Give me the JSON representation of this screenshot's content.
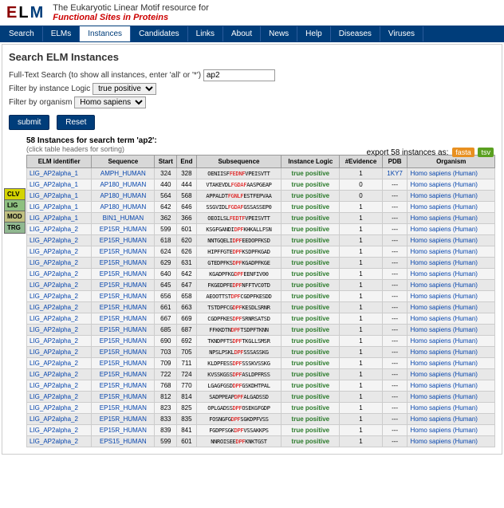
{
  "header": {
    "logo_e": "E",
    "logo_l": "L",
    "logo_m": "M",
    "tagline_1": "The Eukaryotic Linear Motif resource for",
    "tagline_2": "Functional Sites in Proteins"
  },
  "nav": [
    "Search",
    "ELMs",
    "Instances",
    "Candidates",
    "Links",
    "About",
    "News",
    "Help",
    "Diseases",
    "Viruses"
  ],
  "nav_active": 2,
  "page_title": "Search ELM Instances",
  "filters": {
    "fulltext_label": "Full-Text Search (to show all instances, enter 'all' or '*')",
    "fulltext_value": "ap2",
    "logic_label": "Filter by instance Logic",
    "logic_value": "true positive",
    "organism_label": "Filter by organism",
    "organism_value": "Homo sapiens"
  },
  "buttons": {
    "submit": "submit",
    "reset": "Reset"
  },
  "export": {
    "label": "export 58 instances as:",
    "fasta": "fasta",
    "tsv": "tsv"
  },
  "results": {
    "heading": "58 Instances for search term 'ap2':",
    "note": "(click table headers for sorting)"
  },
  "sidetabs": {
    "clv": "CLV",
    "lig": "LIG",
    "mod": "MOD",
    "trg": "TRG"
  },
  "columns": [
    "ELM identifier",
    "Sequence",
    "Start",
    "End",
    "Subsequence",
    "Instance Logic",
    "#Evidence",
    "PDB",
    "Organism"
  ],
  "rows": [
    {
      "id": "LIG_AP2alpha_1",
      "seq": "AMPH_HUMAN",
      "s": 324,
      "e": 328,
      "sub": "OENIISF<r>FEDNF</r>VPEISVTT",
      "logic": "true positive",
      "ev": 1,
      "pdb": "1KY7",
      "org": "Homo sapiens (Human)"
    },
    {
      "id": "LIG_AP2alpha_1",
      "seq": "AP180_HUMAN",
      "s": 440,
      "e": 444,
      "sub": "VTAKEVDL<r>FGDAF</r>AASPGEAP",
      "logic": "true positive",
      "ev": 0,
      "pdb": "---",
      "org": "Homo sapiens (Human)"
    },
    {
      "id": "LIG_AP2alpha_1",
      "seq": "AP180_HUMAN",
      "s": 564,
      "e": 568,
      "sub": "APPALDT<r>FGNLF</r>ESTFEPVAA",
      "logic": "true positive",
      "ev": 0,
      "pdb": "---",
      "org": "Homo sapiens (Human)"
    },
    {
      "id": "LIG_AP2alpha_1",
      "seq": "AP180_HUMAN",
      "s": 642,
      "e": 646,
      "sub": "SSGVIDL<r>FGDAF</r>GSSASSEP0",
      "logic": "true positive",
      "ev": 1,
      "pdb": "---",
      "org": "Homo sapiens (Human)"
    },
    {
      "id": "LIG_AP2alpha_1",
      "seq": "BIN1_HUMAN",
      "s": 362,
      "e": 366,
      "sub": "OEOILSL<r>FEDTF</r>VPEISVTT",
      "logic": "true positive",
      "ev": 1,
      "pdb": "---",
      "org": "Homo sapiens (Human)"
    },
    {
      "id": "LIG_AP2alpha_2",
      "seq": "EP15R_HUMAN",
      "s": 599,
      "e": 601,
      "sub": "KSGFGANDI<r>DPF</r>KHKALLFSN",
      "logic": "true positive",
      "ev": 1,
      "pdb": "---",
      "org": "Homo sapiens (Human)"
    },
    {
      "id": "LIG_AP2alpha_2",
      "seq": "EP15R_HUMAN",
      "s": 618,
      "e": 620,
      "sub": "NNTGQELI<r>DPF</r>EEDOPFKSD",
      "logic": "true positive",
      "ev": 1,
      "pdb": "---",
      "org": "Homo sapiens (Human)"
    },
    {
      "id": "LIG_AP2alpha_2",
      "seq": "EP15R_HUMAN",
      "s": 624,
      "e": 626,
      "sub": "HIPFFGTE<r>DPF</r>KSDPFKGAD",
      "logic": "true positive",
      "ev": 1,
      "pdb": "---",
      "org": "Homo sapiens (Human)"
    },
    {
      "id": "LIG_AP2alpha_2",
      "seq": "EP15R_HUMAN",
      "s": 629,
      "e": 631,
      "sub": "GTEDPFKS<r>DPF</r>KGADPFKGE",
      "logic": "true positive",
      "ev": 1,
      "pdb": "---",
      "org": "Homo sapiens (Human)"
    },
    {
      "id": "LIG_AP2alpha_2",
      "seq": "EP15R_HUMAN",
      "s": 640,
      "e": 642,
      "sub": "KGADPFKG<r>DPF</r>EENFIV00",
      "logic": "true positive",
      "ev": 1,
      "pdb": "---",
      "org": "Homo sapiens (Human)"
    },
    {
      "id": "LIG_AP2alpha_2",
      "seq": "EP15R_HUMAN",
      "s": 645,
      "e": 647,
      "sub": "FKGEDPFE<r>DPF</r>NFFTVC0TD",
      "logic": "true positive",
      "ev": 1,
      "pdb": "---",
      "org": "Homo sapiens (Human)"
    },
    {
      "id": "LIG_AP2alpha_2",
      "seq": "EP15R_HUMAN",
      "s": 656,
      "e": 658,
      "sub": "AEOOTTST<r>DPF</r>CGDPFKESDD",
      "logic": "true positive",
      "ev": 1,
      "pdb": "---",
      "org": "Homo sapiens (Human)"
    },
    {
      "id": "LIG_AP2alpha_2",
      "seq": "EP15R_HUMAN",
      "s": 661,
      "e": 663,
      "sub": "TSTDPFCG<r>DPF</r>KESDLSRNR",
      "logic": "true positive",
      "ev": 1,
      "pdb": "---",
      "org": "Homo sapiens (Human)"
    },
    {
      "id": "LIG_AP2alpha_2",
      "seq": "EP15R_HUMAN",
      "s": 667,
      "e": 669,
      "sub": "CGDPFKES<r>DPF</r>SRNRSATSD",
      "logic": "true positive",
      "ev": 1,
      "pdb": "---",
      "org": "Homo sapiens (Human)"
    },
    {
      "id": "LIG_AP2alpha_2",
      "seq": "EP15R_HUMAN",
      "s": 685,
      "e": 687,
      "sub": "FFKKDTN<r>DPF</r>TSDPFTKNN",
      "logic": "true positive",
      "ev": 1,
      "pdb": "---",
      "org": "Homo sapiens (Human)"
    },
    {
      "id": "LIG_AP2alpha_2",
      "seq": "EP15R_HUMAN",
      "s": 690,
      "e": 692,
      "sub": "TKNDPFTS<r>DPF</r>TKGLLSMSR",
      "logic": "true positive",
      "ev": 1,
      "pdb": "---",
      "org": "Homo sapiens (Human)"
    },
    {
      "id": "LIG_AP2alpha_2",
      "seq": "EP15R_HUMAN",
      "s": 703,
      "e": 705,
      "sub": "NPSLPSKL<r>DPF</r>SSSASSKG",
      "logic": "true positive",
      "ev": 1,
      "pdb": "---",
      "org": "Homo sapiens (Human)"
    },
    {
      "id": "LIG_AP2alpha_2",
      "seq": "EP15R_HUMAN",
      "s": 709,
      "e": 711,
      "sub": "KLDPFESS<r>DPF</r>SSSKVSSKG",
      "logic": "true positive",
      "ev": 1,
      "pdb": "---",
      "org": "Homo sapiens (Human)"
    },
    {
      "id": "LIG_AP2alpha_2",
      "seq": "EP15R_HUMAN",
      "s": 722,
      "e": 724,
      "sub": "KVSSKGSS<r>DPF</r>ASLDPFRSS",
      "logic": "true positive",
      "ev": 1,
      "pdb": "---",
      "org": "Homo sapiens (Human)"
    },
    {
      "id": "LIG_AP2alpha_2",
      "seq": "EP15R_HUMAN",
      "s": 768,
      "e": 770,
      "sub": "LGAGFGSD<r>DPF</r>GSKDHTPAL",
      "logic": "true positive",
      "ev": 1,
      "pdb": "---",
      "org": "Homo sapiens (Human)"
    },
    {
      "id": "LIG_AP2alpha_2",
      "seq": "EP15R_HUMAN",
      "s": 812,
      "e": 814,
      "sub": "SADPPEAP<r>DPF</r>ALGADSSD",
      "logic": "true positive",
      "ev": 1,
      "pdb": "---",
      "org": "Homo sapiens (Human)"
    },
    {
      "id": "LIG_AP2alpha_2",
      "seq": "EP15R_HUMAN",
      "s": 823,
      "e": 825,
      "sub": "OPLGADSS<r>DPF</r>OSEKGFGDP",
      "logic": "true positive",
      "ev": 1,
      "pdb": "---",
      "org": "Homo sapiens (Human)"
    },
    {
      "id": "LIG_AP2alpha_2",
      "seq": "EP15R_HUMAN",
      "s": 833,
      "e": 835,
      "sub": "FOSNGFG<r>DPF</r>SGKDPFVSS",
      "logic": "true positive",
      "ev": 1,
      "pdb": "---",
      "org": "Homo sapiens (Human)"
    },
    {
      "id": "LIG_AP2alpha_2",
      "seq": "EP15R_HUMAN",
      "s": 839,
      "e": 841,
      "sub": "FGDPFSGK<r>DPF</r>VSSAKKPS",
      "logic": "true positive",
      "ev": 1,
      "pdb": "---",
      "org": "Homo sapiens (Human)"
    },
    {
      "id": "LIG_AP2alpha_2",
      "seq": "EPS15_HUMAN",
      "s": 599,
      "e": 601,
      "sub": "NNROISEE<r>DPF</r>KNKTGST",
      "logic": "true positive",
      "ev": 1,
      "pdb": "---",
      "org": "Homo sapiens (Human)"
    }
  ]
}
